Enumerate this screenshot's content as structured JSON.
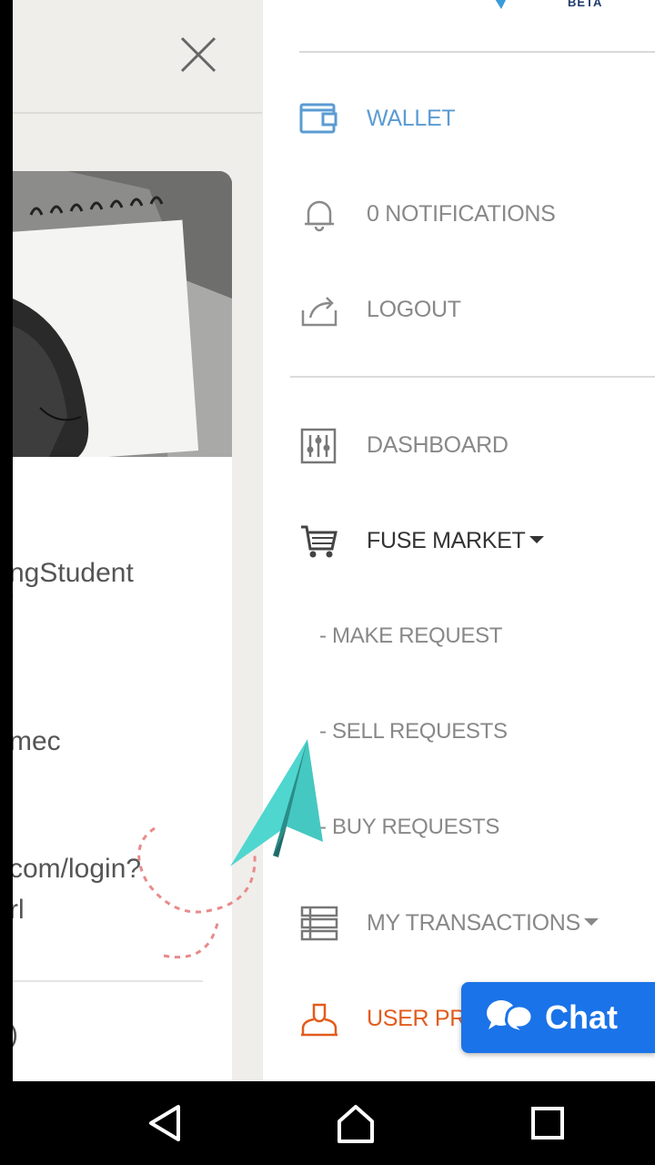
{
  "left_page": {
    "lines": [
      "ngStudent",
      "'",
      "mec",
      "com/login?",
      "rl",
      ")"
    ]
  },
  "drawer": {
    "logo_badge": "BETA",
    "items": [
      {
        "label": "WALLET",
        "icon": "wallet-icon"
      },
      {
        "label": "0 NOTIFICATIONS",
        "icon": "bell-icon"
      },
      {
        "label": "LOGOUT",
        "icon": "logout-icon"
      },
      {
        "label": "DASHBOARD",
        "icon": "sliders-icon"
      },
      {
        "label": "FUSE MARKET",
        "icon": "cart-icon"
      },
      {
        "label": "MY TRANSACTIONS",
        "icon": "list-icon"
      },
      {
        "label": "USER PR",
        "icon": "user-icon"
      }
    ],
    "subitems": [
      "- MAKE REQUEST",
      "- SELL REQUESTS",
      "- BUY REQUESTS"
    ]
  },
  "chat": {
    "label": "Chat",
    "icon": "chat-bubbles-icon"
  },
  "colors": {
    "active": "#5a9bd3",
    "orange": "#e35b1c",
    "chat": "#1a73e8",
    "plane": "#4fd6cf"
  },
  "system_nav": {
    "back": "back-icon",
    "home": "home-icon",
    "recents": "recents-icon"
  }
}
